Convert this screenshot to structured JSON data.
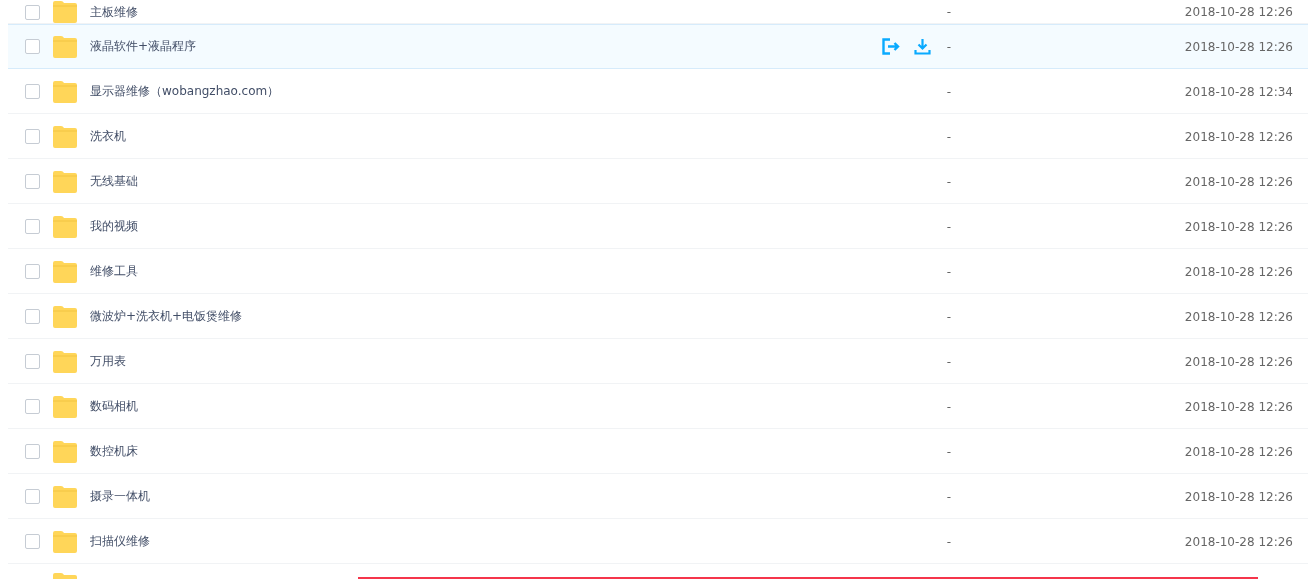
{
  "files": [
    {
      "name": "主板维修",
      "size": "-",
      "date": "2018-10-28 12:26",
      "checked": false,
      "hovered": false
    },
    {
      "name": "液晶软件+液晶程序",
      "size": "-",
      "date": "2018-10-28 12:26",
      "checked": false,
      "hovered": true
    },
    {
      "name": "显示器维修（wobangzhao.com）",
      "size": "-",
      "date": "2018-10-28 12:34",
      "checked": false,
      "hovered": false
    },
    {
      "name": "洗衣机",
      "size": "-",
      "date": "2018-10-28 12:26",
      "checked": false,
      "hovered": false
    },
    {
      "name": "无线基础",
      "size": "-",
      "date": "2018-10-28 12:26",
      "checked": false,
      "hovered": false
    },
    {
      "name": "我的视频",
      "size": "-",
      "date": "2018-10-28 12:26",
      "checked": false,
      "hovered": false
    },
    {
      "name": "维修工具",
      "size": "-",
      "date": "2018-10-28 12:26",
      "checked": false,
      "hovered": false
    },
    {
      "name": "微波炉+洗衣机+电饭煲维修",
      "size": "-",
      "date": "2018-10-28 12:26",
      "checked": false,
      "hovered": false
    },
    {
      "name": "万用表",
      "size": "-",
      "date": "2018-10-28 12:26",
      "checked": false,
      "hovered": false
    },
    {
      "name": "数码相机",
      "size": "-",
      "date": "2018-10-28 12:26",
      "checked": false,
      "hovered": false
    },
    {
      "name": "数控机床",
      "size": "-",
      "date": "2018-10-28 12:26",
      "checked": false,
      "hovered": false
    },
    {
      "name": "摄录一体机",
      "size": "-",
      "date": "2018-10-28 12:26",
      "checked": false,
      "hovered": false
    },
    {
      "name": "扫描仪维修",
      "size": "-",
      "date": "2018-10-28 12:26",
      "checked": false,
      "hovered": false
    }
  ]
}
